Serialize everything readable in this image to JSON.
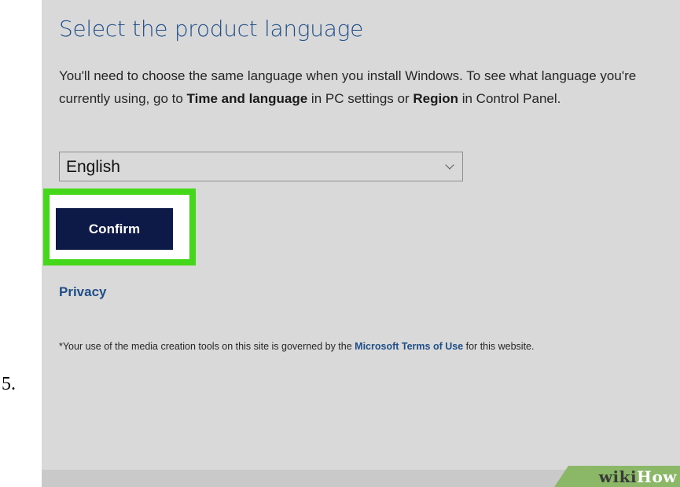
{
  "step": {
    "number": "5."
  },
  "page": {
    "title": "Select the product language",
    "description": {
      "part1": "You'll need to choose the same language when you install Windows. To see what language you're currently using, go to ",
      "bold1": "Time and language",
      "part2": " in PC settings or ",
      "bold2": "Region",
      "part3": " in Control Panel."
    }
  },
  "language_select": {
    "selected": "English"
  },
  "confirm_button": {
    "label": "Confirm"
  },
  "highlight": {
    "color": "#45d81a"
  },
  "privacy_link": {
    "label": "Privacy"
  },
  "terms": {
    "prefix": "*Your use of the media creation tools on this site is governed by the ",
    "link": "Microsoft Terms of Use",
    "suffix": " for this website."
  },
  "watermark": {
    "part1": "wiki",
    "part2": "How"
  },
  "colors": {
    "title_blue": "#1f4e87",
    "button_navy": "#0d1a47",
    "panel_gray": "#d9d9d9"
  }
}
